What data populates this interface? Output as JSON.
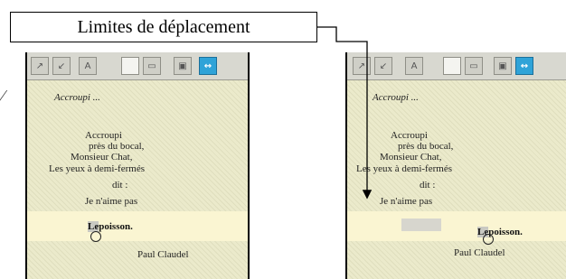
{
  "callout": {
    "text": "Limites de déplacement"
  },
  "margin_mark": "⁄",
  "toolbar": {
    "buttons": [
      {
        "name": "undo-button",
        "icon": "undo-icon",
        "glyph": "↗",
        "active": false,
        "page": false
      },
      {
        "name": "redo-button",
        "icon": "redo-icon",
        "glyph": "↙",
        "active": false,
        "page": false
      },
      {
        "name": "font-size-button",
        "icon": "font-size-icon",
        "glyph": "A",
        "active": false,
        "page": false
      },
      {
        "name": "new-page-button",
        "icon": "page-icon",
        "glyph": "",
        "active": false,
        "page": true
      },
      {
        "name": "disabled-button",
        "icon": "disabled-icon",
        "glyph": "▭",
        "active": false,
        "page": false
      },
      {
        "name": "save-button",
        "icon": "save-icon",
        "glyph": "▣",
        "active": false,
        "page": false
      },
      {
        "name": "move-limits-button",
        "icon": "horizontal-arrows-icon",
        "glyph": "↔",
        "active": true,
        "page": false
      }
    ]
  },
  "poem": {
    "title": "Accroupi ...",
    "lines": [
      "Accroupi",
      "près du bocal,",
      "Monsieur Chat,",
      "Les yeux à demi-fermés",
      "dit :",
      "Je n'aime pas"
    ],
    "word": "poisson.",
    "word_start": "Le",
    "author": "Paul Claudel"
  },
  "accent_color": "#2fa3d8"
}
